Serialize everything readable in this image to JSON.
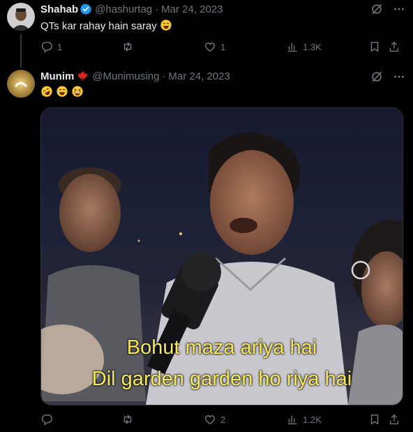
{
  "colors": {
    "background": "#000000",
    "primary_text": "#e7e9ea",
    "secondary_text": "#71767b",
    "verified_badge": "#1d9bf0",
    "maple_leaf": "#d52b1e",
    "caption_yellow": "#f7e95a"
  },
  "tweets": [
    {
      "name": "Shahab",
      "verified": true,
      "handle": "@hashurtag",
      "separator": "·",
      "date": "Mar 24, 2023",
      "text": "QTs kar rahay hain saray",
      "emojis": [
        "face-with-tears-of-joy"
      ],
      "actions": {
        "reply_count": "1",
        "retweet_count": "",
        "like_count": "1",
        "view_count": "1.3K"
      }
    },
    {
      "name": "Munim",
      "name_flag": "maple-leaf-icon",
      "handle": "@Munimusing",
      "separator": "·",
      "date": "Mar 24, 2023",
      "emojis": [
        "rolling-on-floor-laughing",
        "face-with-tears-of-joy",
        "grinning-squinting-face"
      ],
      "media": {
        "caption_line1": "Bohut maza ariya hai",
        "caption_line2": "Dil garden garden ho riya hai"
      },
      "actions": {
        "reply_count": "",
        "retweet_count": "",
        "like_count": "2",
        "view_count": "1.2K"
      }
    }
  ]
}
